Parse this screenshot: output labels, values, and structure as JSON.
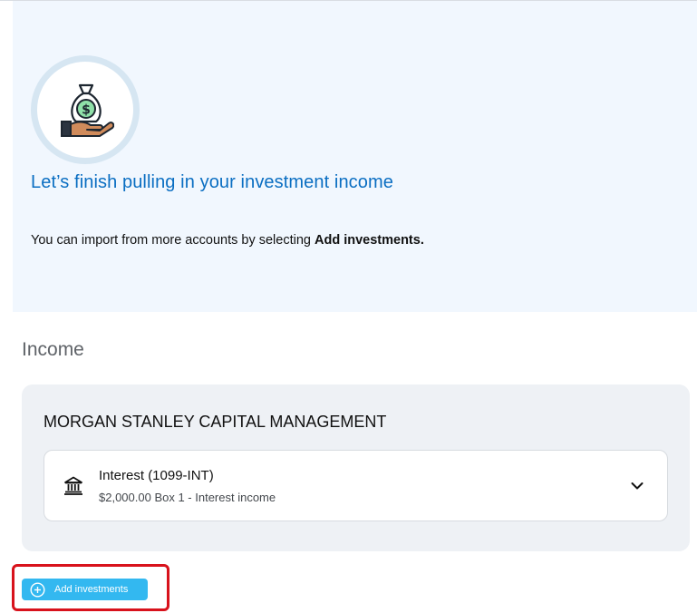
{
  "hero": {
    "title": "Let’s finish pulling in your investment income",
    "description_prefix": "You can import from more accounts by selecting ",
    "description_bold": "Add investments."
  },
  "section": {
    "title": "Income"
  },
  "payer": {
    "name": "MORGAN STANLEY CAPITAL MANAGEMENT",
    "forms": [
      {
        "label": "Interest (1099-INT)",
        "detail": "$2,000.00 Box 1 - Interest income"
      }
    ]
  },
  "actions": {
    "add_investments_label": "Add investments"
  },
  "colors": {
    "accent_blue": "#0a6ec2",
    "button_blue": "#33b8f0",
    "highlight_red": "#d8121c",
    "hero_bg": "#f1f7fe",
    "card_bg": "#eef1f5"
  },
  "icons": {
    "hero": "money-bag-hand-icon",
    "form": "bank-icon",
    "expand": "chevron-down-icon",
    "add": "plus-circle-icon"
  }
}
